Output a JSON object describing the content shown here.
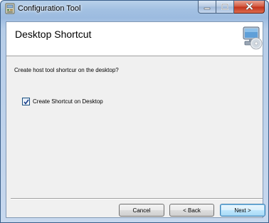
{
  "window": {
    "title": "Configuration Tool"
  },
  "titlebar": {
    "min_icon": "minimize-icon",
    "max_icon": "maximize-icon",
    "close_icon": "close-icon",
    "close_color": "#c7391e"
  },
  "header": {
    "title": "Desktop Shortcut",
    "icon": "computer-disc-icon"
  },
  "main": {
    "description": "Create host tool shortcur on the desktop?",
    "checkbox": {
      "label": "Create Shortcut on Desktop",
      "checked": true
    }
  },
  "footer": {
    "cancel_label": "Cancel",
    "back_label": "< Back",
    "next_label": "Next >"
  }
}
